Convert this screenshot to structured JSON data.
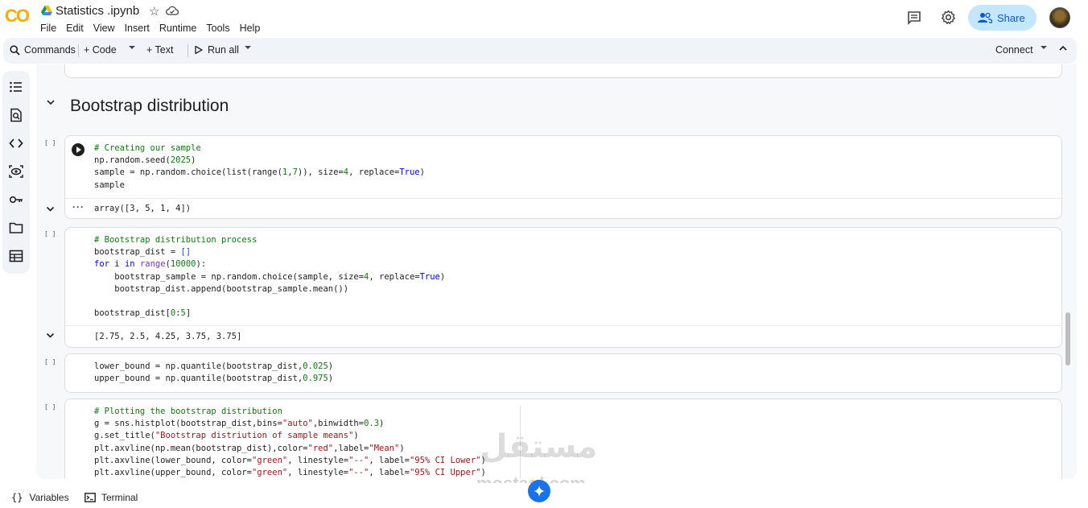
{
  "header": {
    "logo": "CO",
    "notebook_title": "Statistics .ipynb",
    "menu": [
      "File",
      "Edit",
      "View",
      "Insert",
      "Runtime",
      "Tools",
      "Help"
    ],
    "share_label": "Share"
  },
  "toolbar": {
    "commands_label": "Commands",
    "code_label": "+ Code",
    "text_label": "+ Text",
    "run_all_label": "Run all",
    "connect_label": "Connect"
  },
  "rail": {
    "icons": [
      "table-of-contents-icon",
      "find-replace-icon",
      "code-snippets-icon",
      "variables-inspector-icon",
      "secrets-key-icon",
      "files-folder-icon",
      "data-table-icon"
    ]
  },
  "main": {
    "section_title": "Bootstrap distribution",
    "cells": [
      {
        "exec_count": "[ ]",
        "code": [
          "# Creating our sample",
          "np.random.seed(2025)",
          "sample = np.random.choice(list(range(1,7)), size=4, replace=True)",
          "sample"
        ],
        "output": "array([3, 5, 1, 4])"
      },
      {
        "exec_count": "[ ]",
        "code": [
          "# Bootstrap distribution process",
          "bootstrap_dist = []",
          "for i in range(10000):",
          "    bootstrap_sample = np.random.choice(sample, size=4, replace=True)",
          "    bootstrap_dist.append(bootstrap_sample.mean())",
          "",
          "bootstrap_dist[0:5]"
        ],
        "output": "[2.75, 2.5, 4.25, 3.75, 3.75]"
      },
      {
        "exec_count": "[ ]",
        "code": [
          "lower_bound = np.quantile(bootstrap_dist,0.025)",
          "upper_bound = np.quantile(bootstrap_dist,0.975)"
        ]
      },
      {
        "exec_count": "[ ]",
        "code": [
          "# Plotting the bootstrap distribution",
          "g = sns.histplot(bootstrap_dist,bins=\"auto\",binwidth=0.3)",
          "g.set_title(\"Bootstrap distriution of sample means\")",
          "plt.axvline(np.mean(bootstrap_dist),color=\"red\",label=\"Mean\")",
          "plt.axvline(lower_bound, color=\"green\", linestyle=\"--\", label=\"95% CI Lower\")",
          "plt.axvline(upper_bound, color=\"green\", linestyle=\"--\", label=\"95% CI Upper\")"
        ]
      }
    ]
  },
  "watermark": {
    "arabic": "مستقل",
    "latin": "mostaql.com"
  },
  "statusbar": {
    "variables_label": "Variables",
    "terminal_label": "Terminal"
  },
  "colors": {
    "accent": "#0b57d0",
    "share_bg": "#c2e7ff",
    "toolbar_bg": "#f0f4f9",
    "comment_green": "#0d7d0d",
    "string_red": "#a31515",
    "keyword_blue": "#0000ff"
  }
}
